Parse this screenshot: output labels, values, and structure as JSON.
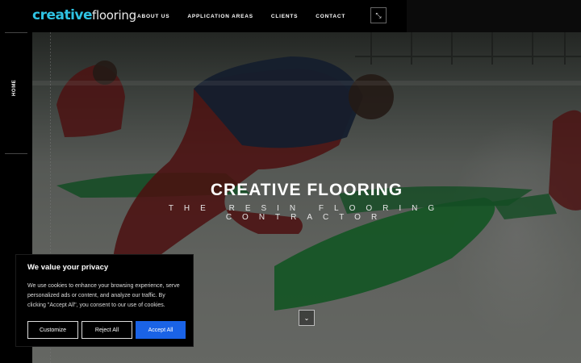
{
  "brand": {
    "logo_part1": "creative",
    "logo_part2": "flooring"
  },
  "nav": {
    "items": [
      "ABOUT US",
      "APPLICATION AREAS",
      "CLIENTS",
      "CONTACT"
    ]
  },
  "menu_button_icon": "expand-arrows-icon",
  "sidebar": {
    "label": "HOME"
  },
  "hero": {
    "title": "CREATIVE FLOORING",
    "subtitle": "THE RESIN FLOORING CONTRACTOR",
    "scroll_icon": "chevron-down-icon"
  },
  "cookie": {
    "heading": "We value your privacy",
    "text": "We use cookies to enhance your browsing experience, serve personalized ads or content, and analyze our traffic. By clicking \"Accept All\", you consent to our use of cookies.",
    "customize": "Customize",
    "reject": "Reject All",
    "accept": "Accept All"
  },
  "colors": {
    "logo_accent": "#2fc3e3",
    "accept_button": "#1a63e6",
    "floor_green": "#1f8a3a"
  }
}
